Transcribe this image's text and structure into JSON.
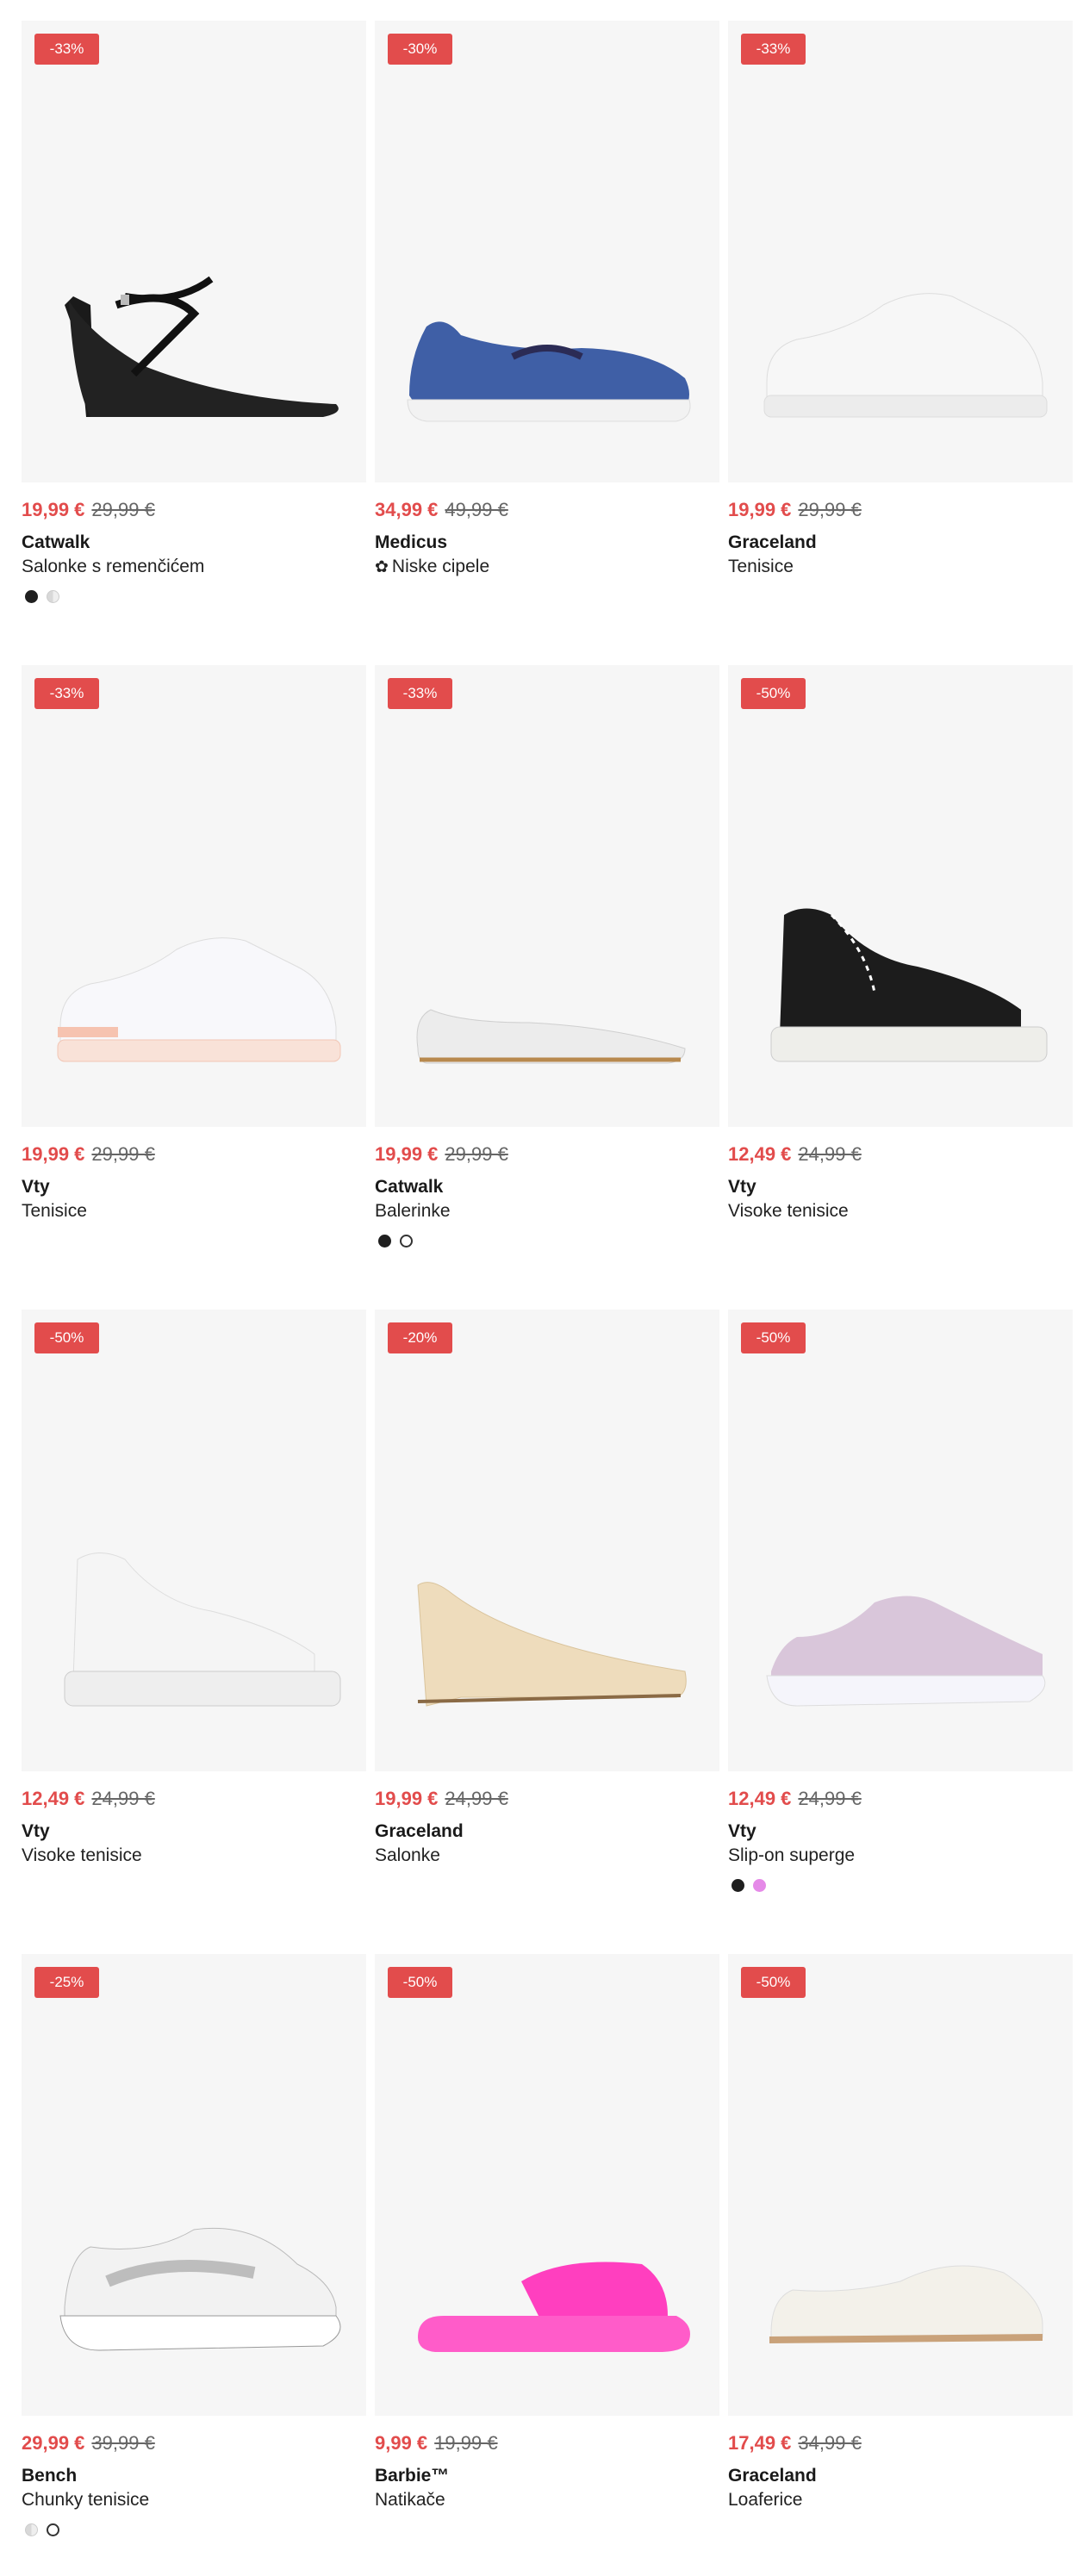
{
  "products": [
    {
      "discount": "-33%",
      "price": "19,99 €",
      "old_price": "29,99 €",
      "brand": "Catwalk",
      "type": "Salonke s remenčićem",
      "swatches": [
        "black",
        "grey"
      ],
      "shoe": "heel-black"
    },
    {
      "discount": "-30%",
      "price": "34,99 €",
      "old_price": "49,99 €",
      "brand": "Medicus",
      "type": "Niske cipele",
      "eco": "✿",
      "swatches": [],
      "shoe": "loafer-blue"
    },
    {
      "discount": "-33%",
      "price": "19,99 €",
      "old_price": "29,99 €",
      "brand": "Graceland",
      "type": "Tenisice",
      "swatches": [],
      "shoe": "sneaker-white"
    },
    {
      "discount": "-33%",
      "price": "19,99 €",
      "old_price": "29,99 €",
      "brand": "Vty",
      "type": "Tenisice",
      "swatches": [],
      "shoe": "sneaker-peach"
    },
    {
      "discount": "-33%",
      "price": "19,99 €",
      "old_price": "29,99 €",
      "brand": "Catwalk",
      "type": "Balerinke",
      "swatches": [
        "black",
        "white"
      ],
      "shoe": "ballet-silver"
    },
    {
      "discount": "-50%",
      "price": "12,49 €",
      "old_price": "24,99 €",
      "brand": "Vty",
      "type": "Visoke tenisice",
      "swatches": [],
      "shoe": "hightop-black"
    },
    {
      "discount": "-50%",
      "price": "12,49 €",
      "old_price": "24,99 €",
      "brand": "Vty",
      "type": "Visoke tenisice",
      "swatches": [],
      "shoe": "hightop-white"
    },
    {
      "discount": "-20%",
      "price": "19,99 €",
      "old_price": "24,99 €",
      "brand": "Graceland",
      "type": "Salonke",
      "swatches": [],
      "shoe": "wedge-beige"
    },
    {
      "discount": "-50%",
      "price": "12,49 €",
      "old_price": "24,99 €",
      "brand": "Vty",
      "type": "Slip-on superge",
      "swatches": [
        "black",
        "pink"
      ],
      "shoe": "knit-lilac"
    },
    {
      "discount": "-25%",
      "price": "29,99 €",
      "old_price": "39,99 €",
      "brand": "Bench",
      "type": "Chunky tenisice",
      "swatches": [
        "grey",
        "white"
      ],
      "shoe": "chunky-white"
    },
    {
      "discount": "-50%",
      "price": "9,99 €",
      "old_price": "19,99 €",
      "brand": "Barbie™",
      "type": "Natikače",
      "swatches": [],
      "shoe": "slide-pink"
    },
    {
      "discount": "-50%",
      "price": "17,49 €",
      "old_price": "34,99 €",
      "brand": "Graceland",
      "type": "Loaferice",
      "swatches": [],
      "shoe": "loafer-cream"
    }
  ],
  "colors": {
    "sale": "#e24c4c",
    "card_bg": "#f6f6f6"
  }
}
